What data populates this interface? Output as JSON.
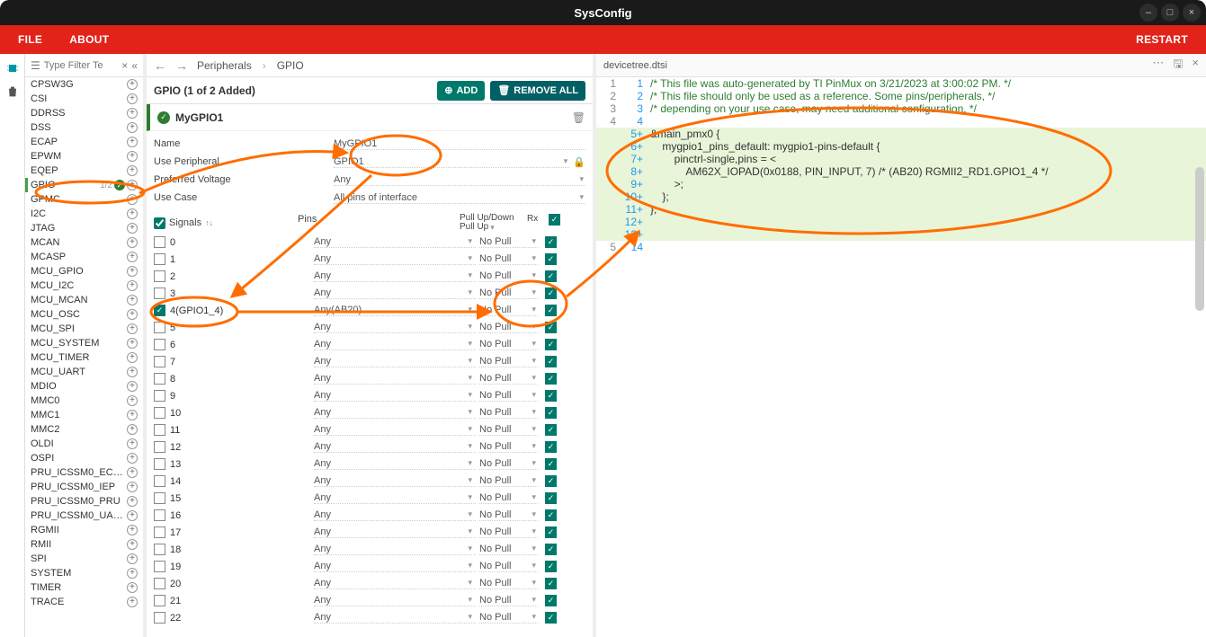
{
  "window": {
    "title": "SysConfig"
  },
  "menubar": {
    "file": "FILE",
    "about": "ABOUT",
    "restart": "RESTART"
  },
  "sidebar": {
    "filter_placeholder": "Type Filter Te",
    "items": [
      {
        "label": "CPSW3G"
      },
      {
        "label": "CSI"
      },
      {
        "label": "DDRSS"
      },
      {
        "label": "DSS"
      },
      {
        "label": "ECAP"
      },
      {
        "label": "EPWM"
      },
      {
        "label": "EQEP"
      },
      {
        "label": "GPIO",
        "frac": "1/2",
        "sel": true,
        "check": true
      },
      {
        "label": "GPMC"
      },
      {
        "label": "I2C"
      },
      {
        "label": "JTAG"
      },
      {
        "label": "MCAN"
      },
      {
        "label": "MCASP"
      },
      {
        "label": "MCU_GPIO"
      },
      {
        "label": "MCU_I2C"
      },
      {
        "label": "MCU_MCAN"
      },
      {
        "label": "MCU_OSC"
      },
      {
        "label": "MCU_SPI"
      },
      {
        "label": "MCU_SYSTEM"
      },
      {
        "label": "MCU_TIMER"
      },
      {
        "label": "MCU_UART"
      },
      {
        "label": "MDIO"
      },
      {
        "label": "MMC0"
      },
      {
        "label": "MMC1"
      },
      {
        "label": "MMC2"
      },
      {
        "label": "OLDI"
      },
      {
        "label": "OSPI"
      },
      {
        "label": "PRU_ICSSM0_EC…"
      },
      {
        "label": "PRU_ICSSM0_IEP"
      },
      {
        "label": "PRU_ICSSM0_PRU"
      },
      {
        "label": "PRU_ICSSM0_UA…"
      },
      {
        "label": "RGMII"
      },
      {
        "label": "RMII"
      },
      {
        "label": "SPI"
      },
      {
        "label": "SYSTEM"
      },
      {
        "label": "TIMER"
      },
      {
        "label": "TRACE"
      }
    ]
  },
  "breadcrumb": {
    "a": "Peripherals",
    "b": "GPIO"
  },
  "panel": {
    "title": "GPIO (1 of 2 Added)",
    "add": "ADD",
    "remove": "REMOVE ALL",
    "instance": "MyGPIO1",
    "form": {
      "name_label": "Name",
      "name_value": "MyGPIO1",
      "periph_label": "Use Peripheral",
      "periph_value": "GPIO1",
      "volt_label": "Preferred Voltage",
      "volt_value": "Any",
      "usecase_label": "Use Case",
      "usecase_value": "All pins of interface"
    },
    "cols": {
      "signals": "Signals",
      "pins": "Pins",
      "pull": "Pull Up/Down",
      "pull_def": "Pull Up",
      "rx": "Rx"
    },
    "rows": [
      {
        "sig": "0",
        "pin": "Any",
        "pull": "No Pull",
        "chk": false
      },
      {
        "sig": "1",
        "pin": "Any",
        "pull": "No Pull",
        "chk": false
      },
      {
        "sig": "2",
        "pin": "Any",
        "pull": "No Pull",
        "chk": false
      },
      {
        "sig": "3",
        "pin": "Any",
        "pull": "No Pull",
        "chk": false
      },
      {
        "sig": "4(GPIO1_4)",
        "pin": "Any(AB20)",
        "pull": "No Pull",
        "chk": true
      },
      {
        "sig": "5",
        "pin": "Any",
        "pull": "No Pull",
        "chk": false
      },
      {
        "sig": "6",
        "pin": "Any",
        "pull": "No Pull",
        "chk": false
      },
      {
        "sig": "7",
        "pin": "Any",
        "pull": "No Pull",
        "chk": false
      },
      {
        "sig": "8",
        "pin": "Any",
        "pull": "No Pull",
        "chk": false
      },
      {
        "sig": "9",
        "pin": "Any",
        "pull": "No Pull",
        "chk": false
      },
      {
        "sig": "10",
        "pin": "Any",
        "pull": "No Pull",
        "chk": false
      },
      {
        "sig": "11",
        "pin": "Any",
        "pull": "No Pull",
        "chk": false
      },
      {
        "sig": "12",
        "pin": "Any",
        "pull": "No Pull",
        "chk": false
      },
      {
        "sig": "13",
        "pin": "Any",
        "pull": "No Pull",
        "chk": false
      },
      {
        "sig": "14",
        "pin": "Any",
        "pull": "No Pull",
        "chk": false
      },
      {
        "sig": "15",
        "pin": "Any",
        "pull": "No Pull",
        "chk": false
      },
      {
        "sig": "16",
        "pin": "Any",
        "pull": "No Pull",
        "chk": false
      },
      {
        "sig": "17",
        "pin": "Any",
        "pull": "No Pull",
        "chk": false
      },
      {
        "sig": "18",
        "pin": "Any",
        "pull": "No Pull",
        "chk": false
      },
      {
        "sig": "19",
        "pin": "Any",
        "pull": "No Pull",
        "chk": false
      },
      {
        "sig": "20",
        "pin": "Any",
        "pull": "No Pull",
        "chk": false
      },
      {
        "sig": "21",
        "pin": "Any",
        "pull": "No Pull",
        "chk": false
      },
      {
        "sig": "22",
        "pin": "Any",
        "pull": "No Pull",
        "chk": false
      }
    ]
  },
  "code": {
    "filename": "devicetree.dtsi",
    "lines": [
      {
        "g1": "1",
        "g2": "1",
        "t": "/* This file was auto-generated by TI PinMux on 3/21/2023 at 3:00:02 PM. */",
        "hl": false,
        "cls": "cmt"
      },
      {
        "g1": "2",
        "g2": "2",
        "t": "/* This file should only be used as a reference. Some pins/peripherals, */",
        "hl": false,
        "cls": "cmt"
      },
      {
        "g1": "3",
        "g2": "3",
        "t": "/* depending on your use case, may need additional configuration. */",
        "hl": false,
        "cls": "cmt"
      },
      {
        "g1": "4",
        "g2": "4",
        "t": "",
        "hl": false,
        "cls": ""
      },
      {
        "g1": "",
        "g2": "5+",
        "t": "&main_pmx0 {",
        "hl": true,
        "cls": ""
      },
      {
        "g1": "",
        "g2": "6+",
        "t": "    mygpio1_pins_default: mygpio1-pins-default {",
        "hl": true,
        "cls": ""
      },
      {
        "g1": "",
        "g2": "7+",
        "t": "        pinctrl-single,pins = <",
        "hl": true,
        "cls": ""
      },
      {
        "g1": "",
        "g2": "8+",
        "t": "            AM62X_IOPAD(0x0188, PIN_INPUT, 7) /* (AB20) RGMII2_RD1.GPIO1_4 */",
        "hl": true,
        "cls": ""
      },
      {
        "g1": "",
        "g2": "9+",
        "t": "        >;",
        "hl": true,
        "cls": ""
      },
      {
        "g1": "",
        "g2": "10+",
        "t": "    };",
        "hl": true,
        "cls": ""
      },
      {
        "g1": "",
        "g2": "11+",
        "t": "};",
        "hl": true,
        "cls": ""
      },
      {
        "g1": "",
        "g2": "12+",
        "t": "",
        "hl": true,
        "cls": ""
      },
      {
        "g1": "",
        "g2": "13+",
        "t": "",
        "hl": true,
        "cls": ""
      },
      {
        "g1": "5",
        "g2": "14",
        "t": "",
        "hl": false,
        "cls": ""
      }
    ]
  },
  "glyph": {
    "check": "✓",
    "plus": "+",
    "x": "×",
    "back": "←",
    "fwd": "→",
    "filter": "⚙",
    "dots": "⋯",
    "save": "🖫",
    "trash": "🗑",
    "lock": "🔒",
    "caret": "▾",
    "collapse": "«",
    "sort": "↑↓",
    "min": "–",
    "max": "□"
  }
}
